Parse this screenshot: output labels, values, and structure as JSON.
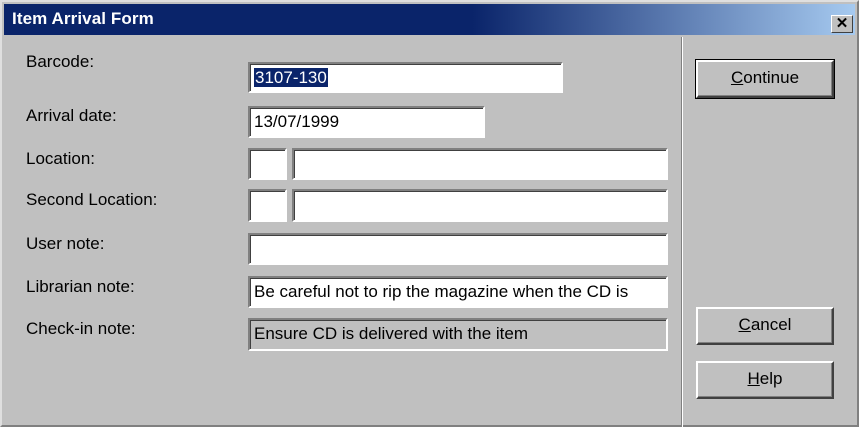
{
  "window": {
    "title": "Item Arrival Form",
    "close_glyph": "✕"
  },
  "form": {
    "barcode": {
      "label": "Barcode:",
      "value": "3107-130"
    },
    "arrival_date": {
      "label": "Arrival date:",
      "value": "13/07/1999"
    },
    "location": {
      "label": "Location:",
      "code": "",
      "value": ""
    },
    "second_location": {
      "label": "Second Location:",
      "code": "",
      "value": ""
    },
    "user_note": {
      "label": "User note:",
      "value": ""
    },
    "librarian_note": {
      "label": "Librarian note:",
      "value": "Be careful not to rip the magazine when the CD is"
    },
    "checkin_note": {
      "label": "Check-in note:",
      "value": "Ensure CD is delivered with the item"
    }
  },
  "buttons": {
    "continue": {
      "accel": "C",
      "rest": "ontinue"
    },
    "cancel": {
      "accel": "C",
      "rest": "ancel"
    },
    "help": {
      "accel": "H",
      "rest": "elp"
    }
  },
  "colors": {
    "title_active": "#0a246a",
    "selection": "#0a246a",
    "face": "#c0c0c0"
  }
}
